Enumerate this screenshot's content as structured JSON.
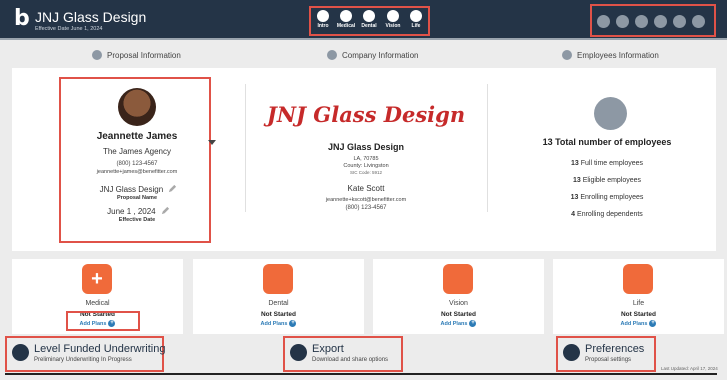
{
  "header": {
    "logo": "b",
    "title": "JNJ Glass Design",
    "subtitle": "Effective Date June 1, 2024",
    "nav": [
      "Intro",
      "Medical",
      "Dental",
      "Vision",
      "Life"
    ],
    "toolbar_icons": [
      "pencil-icon",
      "share-icon",
      "download-icon",
      "list-icon",
      "help-icon",
      "gear-icon"
    ]
  },
  "sections": {
    "proposal": "Proposal Information",
    "company": "Company Information",
    "employees": "Employees Information"
  },
  "agent": {
    "name": "Jeannette James",
    "agency": "The James Agency",
    "phone": "(800) 123-4567",
    "email": "jeannette+james@benefitter.com",
    "proposal_name": "JNJ Glass Design",
    "proposal_name_label": "Proposal Name",
    "effective_date": "June 1 , 2024",
    "effective_date_label": "Effective Date"
  },
  "company": {
    "logo_text": "JNJ Glass Design",
    "name": "JNJ Glass Design",
    "address": "LA, 70785",
    "county": "County: Livingston",
    "sic": "SIC Code: 5912",
    "contact_name": "Kate Scott",
    "contact_email": "jeannette+kscott@benefitter.com",
    "contact_phone": "(800) 123-4567"
  },
  "employees": {
    "total": "13 Total number of employees",
    "stats": [
      {
        "num": "13",
        "label": "Full time employees"
      },
      {
        "num": "13",
        "label": "Eligible employees"
      },
      {
        "num": "13",
        "label": "Enrolling employees"
      },
      {
        "num": "4",
        "label": "Enrolling dependents"
      }
    ]
  },
  "plans": [
    {
      "name": "Medical",
      "status": "Not Started",
      "add": "Add Plans"
    },
    {
      "name": "Dental",
      "status": "Not Started",
      "add": "Add Plans"
    },
    {
      "name": "Vision",
      "status": "Not Started",
      "add": "Add Plans"
    },
    {
      "name": "Life",
      "status": "Not Started",
      "add": "Add Plans"
    }
  ],
  "actions": {
    "underwriting_title": "Level Funded Underwriting",
    "underwriting_sub": "Preliminary Underwriting In Progress",
    "export_title": "Export",
    "export_sub": "Download and share options",
    "prefs_title": "Preferences",
    "prefs_sub": "Proposal settings"
  },
  "last_updated": "Last Updated: April 17, 2024",
  "colors": {
    "header": "#243447",
    "accent": "#f06a3a",
    "highlight": "#e05248",
    "link": "#2c7bb6"
  }
}
